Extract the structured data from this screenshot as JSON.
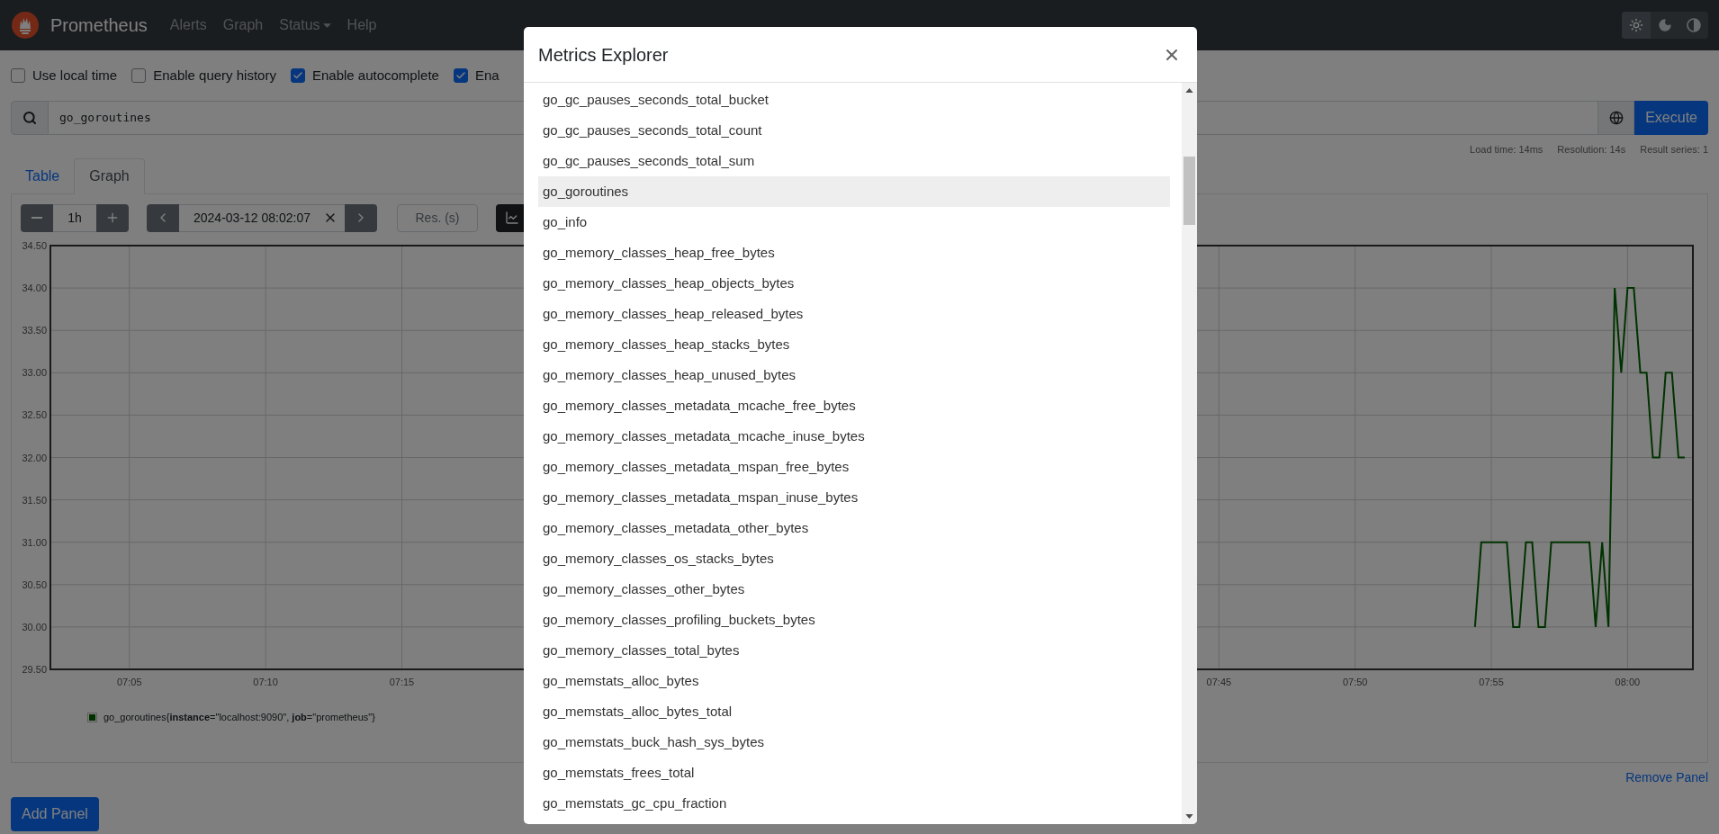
{
  "navbar": {
    "brand": "Prometheus",
    "links": [
      {
        "label": "Alerts",
        "dropdown": false
      },
      {
        "label": "Graph",
        "dropdown": false
      },
      {
        "label": "Status",
        "dropdown": true
      },
      {
        "label": "Help",
        "dropdown": false
      }
    ],
    "theme_options": [
      {
        "kind": "light",
        "selected": true
      },
      {
        "kind": "dark",
        "selected": false
      },
      {
        "kind": "auto",
        "selected": false
      }
    ]
  },
  "options": [
    {
      "label": "Use local time",
      "checked": false
    },
    {
      "label": "Enable query history",
      "checked": false
    },
    {
      "label": "Enable autocomplete",
      "checked": true
    },
    {
      "label": "Ena",
      "checked": true
    }
  ],
  "query": {
    "value": "go_goroutines",
    "execute": "Execute"
  },
  "stats": [
    "Load time: 14ms",
    "Resolution: 14s",
    "Result series: 1"
  ],
  "tabs": [
    {
      "label": "Table",
      "selected": false
    },
    {
      "label": "Graph",
      "selected": true
    }
  ],
  "controls": {
    "range": "1h",
    "end_time": "2024-03-12 08:02:07",
    "resolution_placeholder": "Res. (s)"
  },
  "graph": {
    "chart_data": {
      "type": "line",
      "x": [
        474.4,
        474.63,
        474.87,
        475.1,
        475.33,
        475.57,
        475.8,
        476.03,
        476.27,
        476.5,
        476.73,
        476.97,
        477.2,
        477.43,
        477.67,
        477.9,
        478.13,
        478.37,
        478.6,
        478.83,
        479.07,
        479.3,
        479.53,
        479.77,
        480.0,
        480.23,
        480.47,
        480.7,
        480.93,
        481.17,
        481.4,
        481.63,
        481.87,
        482.1
      ],
      "series": [
        {
          "name": "go_goroutines{**instance**=\"localhost:9090\", **job**=\"prometheus\"}",
          "color": "#006400",
          "values": [
            30,
            31,
            31,
            31,
            31,
            31,
            30,
            30,
            31,
            31,
            30,
            30,
            31,
            31,
            31,
            31,
            31,
            31,
            31,
            30,
            31,
            30,
            34,
            33,
            34,
            34,
            33,
            33,
            32,
            32,
            33,
            33,
            32,
            32
          ]
        }
      ],
      "grid": true,
      "xlim": [
        422.1,
        482.4
      ],
      "ylim": [
        29.5,
        34.5
      ],
      "xticks": [
        {
          "value": 425,
          "label": "07:05"
        },
        {
          "value": 430,
          "label": "07:10"
        },
        {
          "value": 435,
          "label": "07:15"
        },
        {
          "value": 465,
          "label": "07:45"
        },
        {
          "value": 470,
          "label": "07:50"
        },
        {
          "value": 475,
          "label": "07:55"
        },
        {
          "value": 480,
          "label": "08:00"
        }
      ],
      "yticks": [
        {
          "value": 29.5,
          "label": "29.50"
        },
        {
          "value": 30,
          "label": "30.00"
        },
        {
          "value": 30.5,
          "label": "30.50"
        },
        {
          "value": 31,
          "label": "31.00"
        },
        {
          "value": 31.5,
          "label": "31.50"
        },
        {
          "value": 32,
          "label": "32.00"
        },
        {
          "value": 32.5,
          "label": "32.50"
        },
        {
          "value": 33,
          "label": "33.00"
        },
        {
          "value": 33.5,
          "label": "33.50"
        },
        {
          "value": 34,
          "label": "34.00"
        },
        {
          "value": 34.5,
          "label": "34.50"
        }
      ]
    },
    "legend_marker": true
  },
  "remove_panel": "Remove Panel",
  "add_panel": "Add Panel",
  "modal": {
    "title": "Metrics Explorer",
    "metrics": [
      {
        "name": "go_gc_pauses_seconds_total_bucket",
        "selected": false
      },
      {
        "name": "go_gc_pauses_seconds_total_count",
        "selected": false
      },
      {
        "name": "go_gc_pauses_seconds_total_sum",
        "selected": false
      },
      {
        "name": "go_goroutines",
        "selected": true
      },
      {
        "name": "go_info",
        "selected": false
      },
      {
        "name": "go_memory_classes_heap_free_bytes",
        "selected": false
      },
      {
        "name": "go_memory_classes_heap_objects_bytes",
        "selected": false
      },
      {
        "name": "go_memory_classes_heap_released_bytes",
        "selected": false
      },
      {
        "name": "go_memory_classes_heap_stacks_bytes",
        "selected": false
      },
      {
        "name": "go_memory_classes_heap_unused_bytes",
        "selected": false
      },
      {
        "name": "go_memory_classes_metadata_mcache_free_bytes",
        "selected": false
      },
      {
        "name": "go_memory_classes_metadata_mcache_inuse_bytes",
        "selected": false
      },
      {
        "name": "go_memory_classes_metadata_mspan_free_bytes",
        "selected": false
      },
      {
        "name": "go_memory_classes_metadata_mspan_inuse_bytes",
        "selected": false
      },
      {
        "name": "go_memory_classes_metadata_other_bytes",
        "selected": false
      },
      {
        "name": "go_memory_classes_os_stacks_bytes",
        "selected": false
      },
      {
        "name": "go_memory_classes_other_bytes",
        "selected": false
      },
      {
        "name": "go_memory_classes_profiling_buckets_bytes",
        "selected": false
      },
      {
        "name": "go_memory_classes_total_bytes",
        "selected": false
      },
      {
        "name": "go_memstats_alloc_bytes",
        "selected": false
      },
      {
        "name": "go_memstats_alloc_bytes_total",
        "selected": false
      },
      {
        "name": "go_memstats_buck_hash_sys_bytes",
        "selected": false
      },
      {
        "name": "go_memstats_frees_total",
        "selected": false
      },
      {
        "name": "go_memstats_gc_cpu_fraction",
        "selected": false
      }
    ]
  }
}
